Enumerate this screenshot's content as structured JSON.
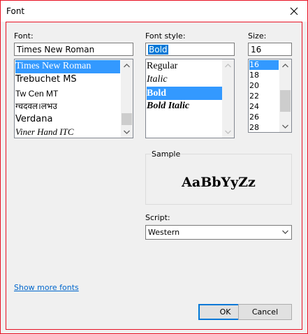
{
  "window": {
    "title": "Font"
  },
  "font": {
    "label": "Font:",
    "value": "Times New Roman",
    "items": [
      "Times New Roman",
      "Trebuchet MS",
      "Tw Cen MT",
      "ग्चदवल।लभउ",
      "Verdana",
      "Viner Hand ITC"
    ],
    "selected_index": 0
  },
  "style": {
    "label": "Font style:",
    "value": "Bold",
    "items": [
      "Regular",
      "Italic",
      "Bold",
      "Bold Italic"
    ],
    "selected_index": 2
  },
  "size": {
    "label": "Size:",
    "value": "16",
    "items": [
      "16",
      "18",
      "20",
      "22",
      "24",
      "26",
      "28"
    ],
    "selected_index": 0
  },
  "sample": {
    "label": "Sample",
    "text": "AaBbYyZz"
  },
  "script": {
    "label": "Script:",
    "value": "Western"
  },
  "links": {
    "show_more": "Show more fonts"
  },
  "buttons": {
    "ok": "OK",
    "cancel": "Cancel"
  },
  "colors": {
    "accent": "#0078d7",
    "selection": "#3399ff",
    "focus_border": "#e81123"
  }
}
